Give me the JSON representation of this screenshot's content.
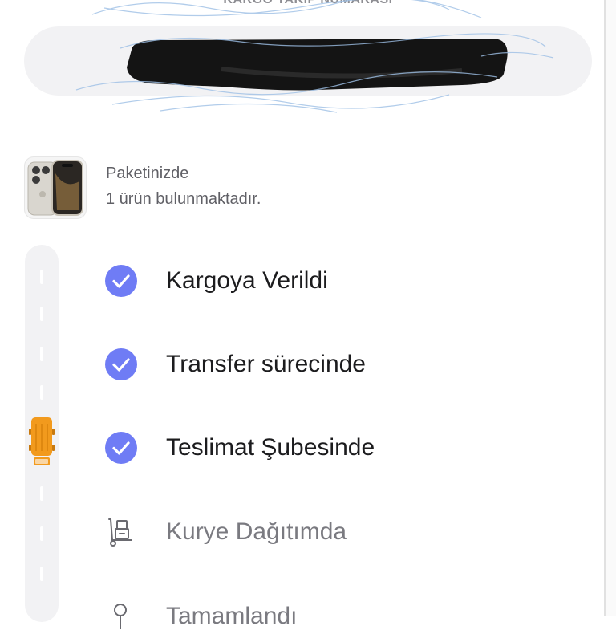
{
  "tracking": {
    "title": "KARGO TAKİP NUMARASI",
    "number_redacted": true
  },
  "package": {
    "line1": "Paketinizde",
    "line2": "1 ürün bulunmaktadır.",
    "product_image": "phone-product-image"
  },
  "steps": [
    {
      "label": "Kargoya Verildi",
      "status": "done",
      "icon": "check-circle-icon"
    },
    {
      "label": "Transfer sürecinde",
      "status": "done",
      "icon": "check-circle-icon"
    },
    {
      "label": "Teslimat Şubesinde",
      "status": "done",
      "icon": "check-circle-icon"
    },
    {
      "label": "Kurye Dağıtımda",
      "status": "pending",
      "icon": "hand-truck-icon"
    },
    {
      "label": "Tamamlandı",
      "status": "pending",
      "icon": "pin-icon"
    }
  ],
  "progress": {
    "current_step": 3,
    "indicator_icon": "truck-icon"
  },
  "colors": {
    "accent": "#6f7cf5",
    "indicator": "#f29a1d",
    "done_text": "#1c1c1e",
    "pending_text": "#7a7a80",
    "field_bg": "#f2f2f4"
  }
}
